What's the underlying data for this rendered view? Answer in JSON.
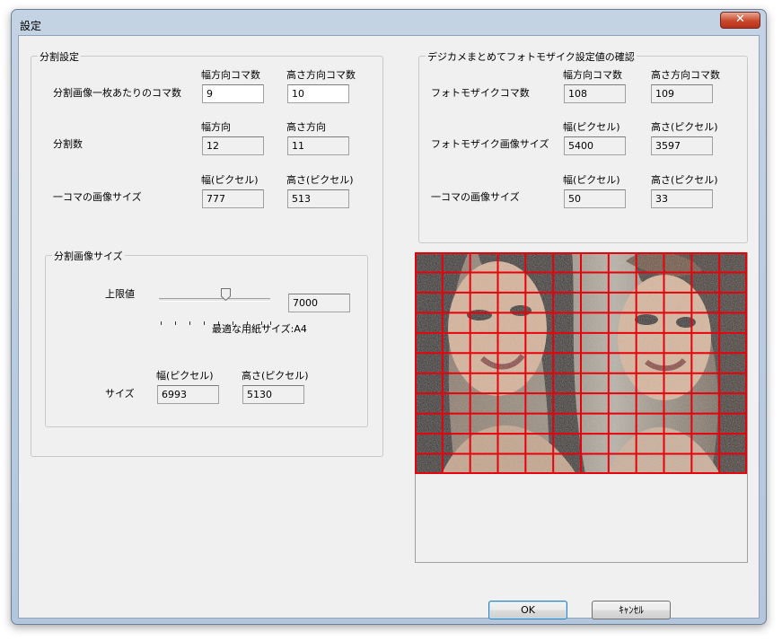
{
  "window": {
    "title": "設定",
    "close_label": "✕"
  },
  "split_settings": {
    "legend": "分割設定",
    "col_header_width": "幅方向コマ数",
    "col_header_height": "高さ方向コマ数",
    "row_frames_label": "分割画像一枚あたりのコマ数",
    "frames_width": "9",
    "frames_height": "10",
    "dir_header_width": "幅方向",
    "dir_header_height": "高さ方向",
    "row_count_label": "分割数",
    "count_width": "12",
    "count_height": "11",
    "px_header_width": "幅(ピクセル)",
    "px_header_height": "高さ(ピクセル)",
    "row_frame_size_label": "一コマの画像サイズ",
    "frame_px_width": "777",
    "frame_px_height": "513"
  },
  "split_image_size": {
    "legend": "分割画像サイズ",
    "upper_limit_label": "上限値",
    "upper_limit_value": "7000",
    "slider_level": 0.55,
    "paper_size_text": "最適な用紙サイズ:A4",
    "px_header_width": "幅(ピクセル)",
    "px_header_height": "高さ(ピクセル)",
    "size_label": "サイズ",
    "size_width": "6993",
    "size_height": "5130"
  },
  "confirm": {
    "legend": "デジカメまとめてフォトモザイク設定値の確認",
    "col_header_width": "幅方向コマ数",
    "col_header_height": "高さ方向コマ数",
    "row_frames_label": "フォトモザイクコマ数",
    "frames_width": "108",
    "frames_height": "109",
    "px_header_width": "幅(ピクセル)",
    "px_header_height": "高さ(ピクセル)",
    "row_image_size_label": "フォトモザイク画像サイズ",
    "image_width": "5400",
    "image_height": "3597",
    "px_header_width2": "幅(ピクセル)",
    "px_header_height2": "高さ(ピクセル)",
    "row_frame_size_label": "一コマの画像サイズ",
    "frame_width": "50",
    "frame_height": "33"
  },
  "preview": {
    "grid_columns": 12,
    "grid_rows": 11,
    "grid_color": "#e8000b"
  },
  "buttons": {
    "ok": "OK",
    "cancel": "ｷｬﾝｾﾙ"
  }
}
